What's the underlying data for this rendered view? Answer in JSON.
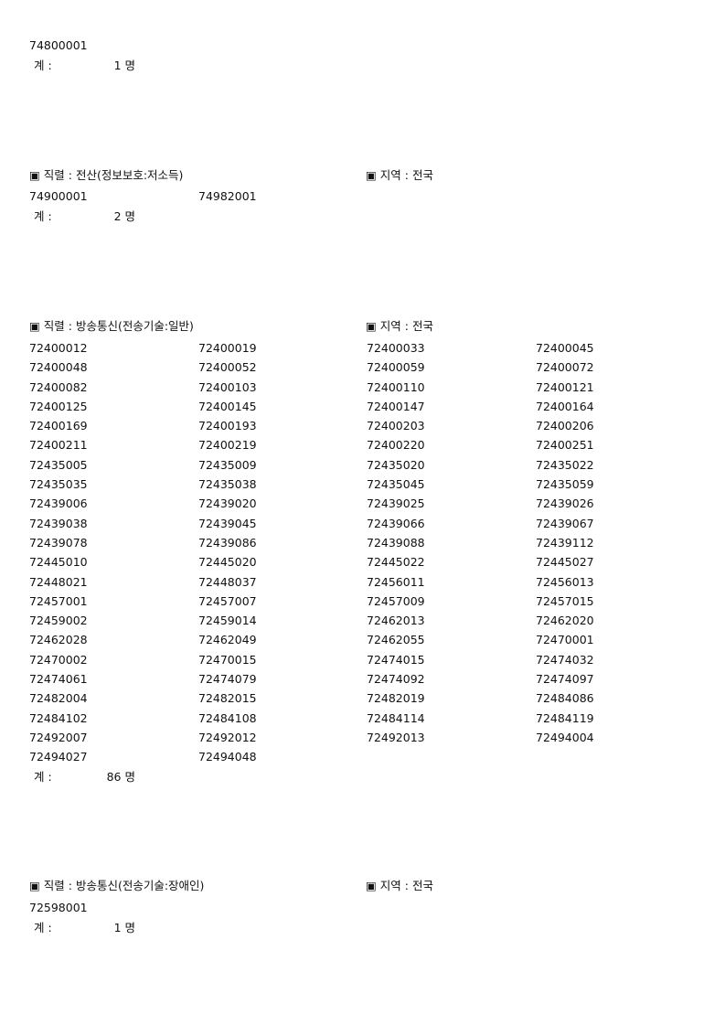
{
  "section0": {
    "numbers": [
      "74800001"
    ],
    "total_label": "계 :",
    "total_value": "1 명"
  },
  "section1": {
    "series_header": "▣ 직렬 : 전산(정보보호:저소득)",
    "region_header": "▣ 지역  : 전국",
    "numbers": [
      "74900001",
      "74982001"
    ],
    "total_label": "계 :",
    "total_value": "2 명"
  },
  "section2": {
    "series_header": "▣ 직렬 : 방송통신(전송기술:일반)",
    "region_header": "▣ 지역  : 전국",
    "numbers": [
      "72400012",
      "72400019",
      "72400033",
      "72400045",
      "72400048",
      "72400052",
      "72400059",
      "72400072",
      "72400082",
      "72400103",
      "72400110",
      "72400121",
      "72400125",
      "72400145",
      "72400147",
      "72400164",
      "72400169",
      "72400193",
      "72400203",
      "72400206",
      "72400211",
      "72400219",
      "72400220",
      "72400251",
      "72435005",
      "72435009",
      "72435020",
      "72435022",
      "72435035",
      "72435038",
      "72435045",
      "72435059",
      "72439006",
      "72439020",
      "72439025",
      "72439026",
      "72439038",
      "72439045",
      "72439066",
      "72439067",
      "72439078",
      "72439086",
      "72439088",
      "72439112",
      "72445010",
      "72445020",
      "72445022",
      "72445027",
      "72448021",
      "72448037",
      "72456011",
      "72456013",
      "72457001",
      "72457007",
      "72457009",
      "72457015",
      "72459002",
      "72459014",
      "72462013",
      "72462020",
      "72462028",
      "72462049",
      "72462055",
      "72470001",
      "72470002",
      "72470015",
      "72474015",
      "72474032",
      "72474061",
      "72474079",
      "72474092",
      "72474097",
      "72482004",
      "72482015",
      "72482019",
      "72484086",
      "72484102",
      "72484108",
      "72484114",
      "72484119",
      "72492007",
      "72492012",
      "72492013",
      "72494004",
      "72494027",
      "72494048"
    ],
    "total_label": "계 :",
    "total_value": "86 명"
  },
  "section3": {
    "series_header": "▣ 직렬 : 방송통신(전송기술:장애인)",
    "region_header": "▣ 지역  : 전국",
    "numbers": [
      "72598001"
    ],
    "total_label": "계 :",
    "total_value": "1 명"
  }
}
